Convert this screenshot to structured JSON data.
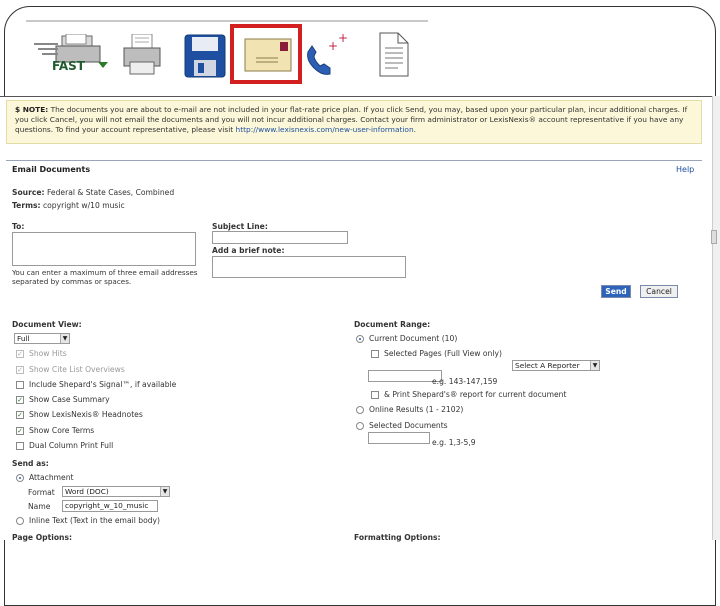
{
  "toolbar": {
    "icons": [
      "fast-print-icon",
      "print-icon",
      "save-icon",
      "email-icon",
      "fax-icon",
      "document-icon"
    ],
    "fast_label": "FAST"
  },
  "note": {
    "prefix": "$ NOTE:",
    "text": "The documents you are about to e-mail are not included in your flat-rate price plan. If you click Send, you may, based upon your particular plan, incur additional charges. If you click Cancel, you will not email the documents and you will not incur additional charges. Contact your firm administrator or LexisNexis® account representative if you have any questions. To find your account representative, please visit",
    "link": "http://www.lexisnexis.com/new-user-information",
    "suffix": "."
  },
  "email": {
    "header": "Email Documents",
    "help": "Help",
    "source_label": "Source:",
    "source_value": "Federal & State Cases, Combined",
    "terms_label": "Terms:",
    "terms_value": "copyright w/10 music",
    "to_label": "To:",
    "to_hint": "You can enter a maximum of three email addresses separated by commas or spaces.",
    "subject_label": "Subject Line:",
    "note_label": "Add a brief note:",
    "send": "Send",
    "cancel": "Cancel"
  },
  "document_view": {
    "label": "Document View:",
    "selected": "Full",
    "options": [
      {
        "label": "Show Hits",
        "checked": true,
        "disabled": true
      },
      {
        "label": "Show Cite List Overviews",
        "checked": true,
        "disabled": true
      },
      {
        "label": "Include Shepard's Signal™, if available",
        "checked": false,
        "disabled": false
      },
      {
        "label": "Show Case Summary",
        "checked": true,
        "disabled": false
      },
      {
        "label": "Show LexisNexis® Headnotes",
        "checked": true,
        "disabled": false
      },
      {
        "label": "Show Core Terms",
        "checked": true,
        "disabled": false
      },
      {
        "label": "Dual Column Print Full",
        "checked": false,
        "disabled": false
      }
    ]
  },
  "send_as": {
    "label": "Send as:",
    "attachment": "Attachment",
    "format_label": "Format",
    "format_value": "Word (DOC)",
    "name_label": "Name",
    "name_value": "copyright_w_10_music",
    "inline": "Inline Text (Text in the email body)"
  },
  "document_range": {
    "label": "Document Range:",
    "current": "Current Document (10)",
    "selected_pages": "Selected Pages (Full View only)",
    "reporter_select": "Select A Reporter",
    "pages_example": "e.g. 143-147,159",
    "print_shepards": "& Print Shepard's® report for current document",
    "online_results": "Online Results (1 - 2102)",
    "selected_docs": "Selected Documents",
    "docs_example": "e.g. 1,3-5,9"
  },
  "page_options_label": "Page Options:",
  "formatting_label": "Formatting Options:"
}
